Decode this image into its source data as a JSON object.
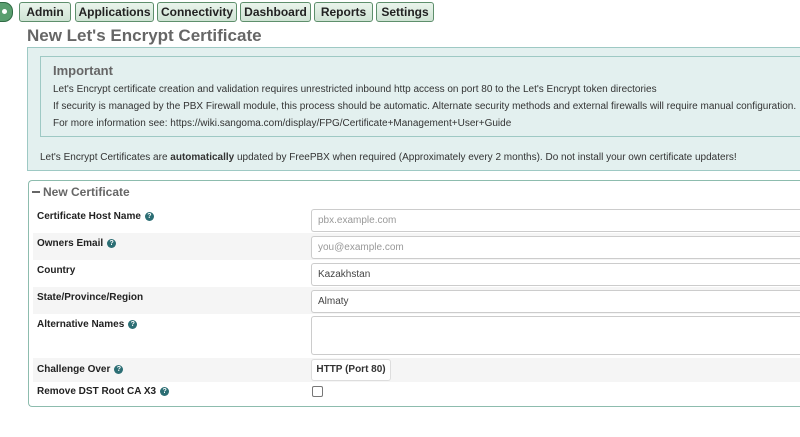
{
  "nav": {
    "items": [
      "Admin",
      "Applications",
      "Connectivity",
      "Dashboard",
      "Reports",
      "Settings"
    ]
  },
  "page_title": "New Let's Encrypt Certificate",
  "important": {
    "heading": "Important",
    "lines": [
      "Let's Encrypt certificate creation and validation requires unrestricted inbound http access on port 80 to the Let's Encrypt token directories",
      "If security is managed by the PBX Firewall module, this process should be automatic. Alternate security methods and external firewalls will require manual configuration.",
      "For more information see: https://wiki.sangoma.com/display/FPG/Certificate+Management+User+Guide"
    ]
  },
  "auto_update": {
    "prefix": "Let's Encrypt Certificates are ",
    "emphasis": "automatically",
    "suffix": " updated by FreePBX when required (Approximately every 2 months). Do not install your own certificate updaters!"
  },
  "form": {
    "legend": "New Certificate",
    "host_label": "Certificate Host Name",
    "host_placeholder": "pbx.example.com",
    "email_label": "Owners Email",
    "email_placeholder": "you@example.com",
    "country_label": "Country",
    "country_value": "Kazakhstan",
    "state_label": "State/Province/Region",
    "state_value": "Almaty",
    "altnames_label": "Alternative Names",
    "challenge_label": "Challenge Over",
    "challenge_option": "HTTP (Port 80)",
    "dst_label": "Remove DST Root CA X3",
    "help_glyph": "?"
  }
}
